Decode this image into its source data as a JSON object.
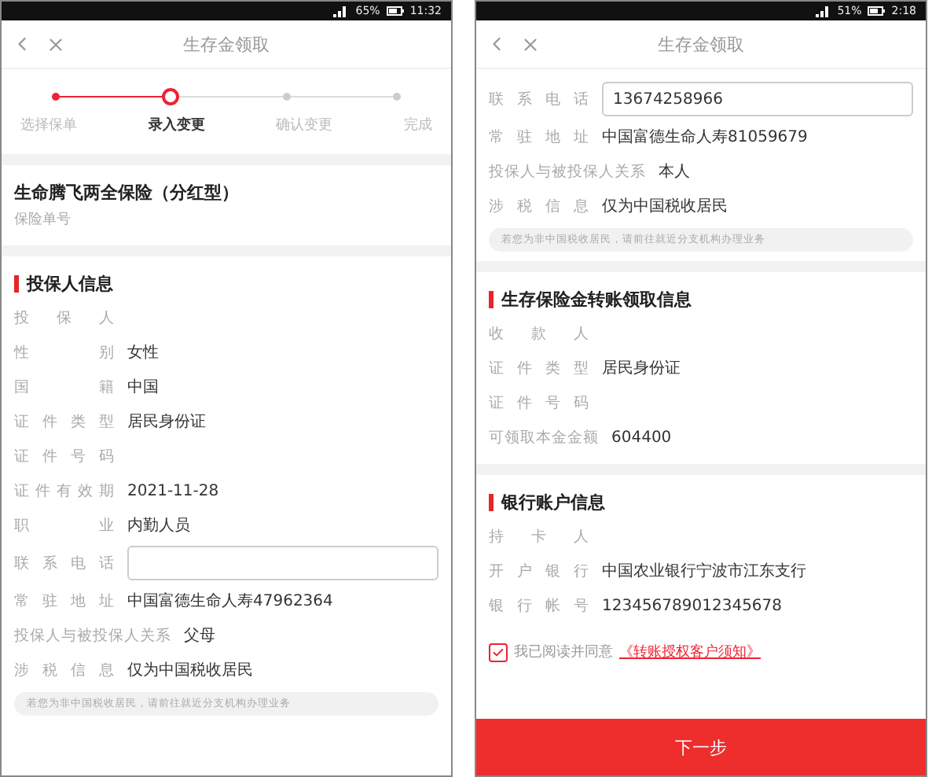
{
  "phones": [
    {
      "status_bar": {
        "battery": "65%",
        "time": "11:32"
      },
      "header": {
        "title": "生存金领取"
      },
      "blocks": [
        {
          "kind": "stepper",
          "steps": [
            {
              "label": "选择保单",
              "completed": true,
              "selected": false
            },
            {
              "label": "录入变更",
              "completed": false,
              "selected": true
            },
            {
              "label": "确认变更",
              "completed": false,
              "selected": false
            },
            {
              "label": "完成",
              "completed": false,
              "selected": false
            }
          ]
        },
        {
          "kind": "product",
          "title": "生命腾飞两全保险（分红型）",
          "subtitle": "保险单号"
        },
        {
          "kind": "section",
          "heading": "投保人信息",
          "rows": [
            {
              "kind": "text",
              "label": "投保人"
            },
            {
              "kind": "text",
              "label": "性别",
              "value": "女性"
            },
            {
              "kind": "text",
              "label": "国籍",
              "value": "中国"
            },
            {
              "kind": "text",
              "label": "证件类型",
              "value": "居民身份证"
            },
            {
              "kind": "text",
              "label": "证件号码"
            },
            {
              "kind": "text",
              "label": "证件有效期",
              "value": "2021-11-28"
            },
            {
              "kind": "text",
              "label": "职业",
              "value": "内勤人员"
            },
            {
              "kind": "input",
              "label": "联系电话"
            },
            {
              "kind": "text",
              "label": "常驻地址",
              "value": "中国富德生命人寿47962364"
            },
            {
              "kind": "text",
              "label": "投保人与被投保人关系",
              "value": "父母"
            },
            {
              "kind": "text",
              "label": "涉税信息",
              "value": "仅为中国税收居民"
            }
          ],
          "tip": "若您为非中国税收居民，请前往就近分支机构办理业务"
        }
      ]
    },
    {
      "status_bar": {
        "battery": "51%",
        "time": "2:18"
      },
      "header": {
        "title": "生存金领取"
      },
      "blocks": [
        {
          "kind": "section",
          "rows": [
            {
              "kind": "input",
              "label": "联系电话",
              "value": "13674258966"
            },
            {
              "kind": "text",
              "label": "常驻地址",
              "value": "中国富德生命人寿81059679"
            },
            {
              "kind": "text",
              "label": "投保人与被投保人关系",
              "value": "本人"
            },
            {
              "kind": "text",
              "label": "涉税信息",
              "value": "仅为中国税收居民"
            }
          ],
          "tip": "若您为非中国税收居民，请前往就近分支机构办理业务"
        },
        {
          "kind": "section",
          "heading": "生存保险金转账领取信息",
          "rows": [
            {
              "kind": "text",
              "label": "收款人"
            },
            {
              "kind": "text",
              "label": "证件类型",
              "value": "居民身份证"
            },
            {
              "kind": "text",
              "label": "证件号码"
            },
            {
              "kind": "text",
              "label": "可领取本金金额",
              "value": "604400"
            }
          ]
        },
        {
          "kind": "section",
          "heading": "银行账户信息",
          "rows": [
            {
              "kind": "text",
              "label": "持卡人"
            },
            {
              "kind": "text",
              "label": "开户银行",
              "value": "中国农业银行宁波市江东支行"
            },
            {
              "kind": "text",
              "label": "银行帐号",
              "value": "123456789012345678"
            }
          ]
        },
        {
          "kind": "agreement",
          "checked": true,
          "text": "我已阅读并同意",
          "link": "《转账授权客户须知》"
        }
      ],
      "button": "下一步"
    }
  ]
}
